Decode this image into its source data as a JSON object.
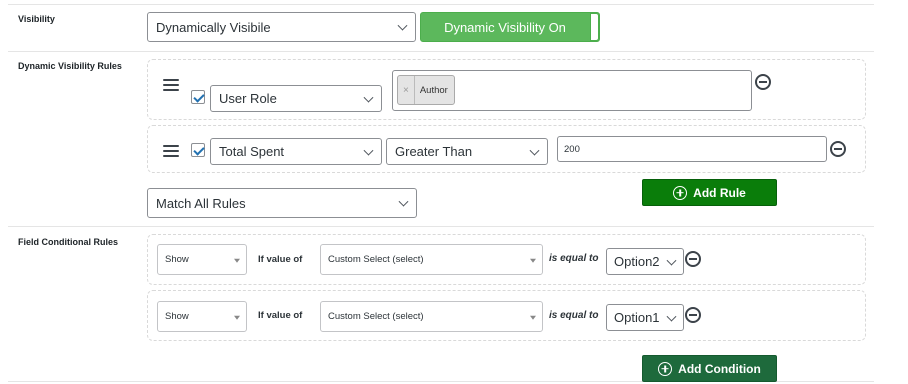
{
  "visibility": {
    "label": "Visibility",
    "select_value": "Dynamically Visibile",
    "toggle_label": "Dynamic Visibility On"
  },
  "dynamic_rules": {
    "label": "Dynamic Visibility Rules",
    "rules": [
      {
        "field": "User Role",
        "tags": [
          "Author"
        ],
        "checked": true
      },
      {
        "field": "Total Spent",
        "operator": "Greater Than",
        "value": "200",
        "checked": true
      }
    ],
    "add_rule_label": "Add Rule",
    "match_value": "Match All Rules"
  },
  "field_conditional": {
    "label": "Field Conditional Rules",
    "conditions": [
      {
        "action": "Show",
        "if_value_of": "If value of",
        "field": "Custom Select (select)",
        "is_equal_to": "is equal to",
        "option": "Option2"
      },
      {
        "action": "Show",
        "if_value_of": "If value of",
        "field": "Custom Select (select)",
        "is_equal_to": "is equal to",
        "option": "Option1"
      }
    ],
    "add_condition_label": "Add Condition"
  },
  "colors": {
    "toggle_green": "#5cb85c",
    "add_rule_green": "#0a7d0a",
    "add_condition_green": "#1e6a3c"
  }
}
